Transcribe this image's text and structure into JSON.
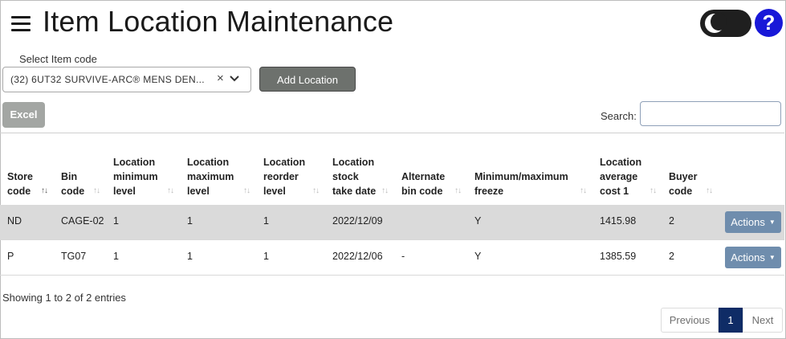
{
  "header": {
    "title": "Item Location Maintenance"
  },
  "item_select": {
    "label": "Select Item code",
    "value": "(32) 6UT32 SURVIVE-ARC® MENS DEN...",
    "clear_symbol": "×"
  },
  "buttons": {
    "add_location": "Add Location",
    "excel": "Excel",
    "actions": "Actions",
    "help": "?"
  },
  "search": {
    "label": "Search:",
    "value": ""
  },
  "table": {
    "columns": [
      "Store code",
      "Bin code",
      "Location minimum level",
      "Location maximum level",
      "Location reorder level",
      "Location stock take date",
      "Alternate bin code",
      "Minimum/maximum freeze",
      "Location average cost 1",
      "Buyer code"
    ],
    "rows": [
      {
        "store": "ND",
        "bin": "CAGE-02",
        "min": "1",
        "max": "1",
        "reorder": "1",
        "date": "2022/12/09",
        "alt": "",
        "freeze": "Y",
        "cost": "1415.98",
        "buyer": "2"
      },
      {
        "store": "P",
        "bin": "TG07",
        "min": "1",
        "max": "1",
        "reorder": "1",
        "date": "2022/12/06",
        "alt": "-",
        "freeze": "Y",
        "cost": "1385.59",
        "buyer": "2"
      }
    ]
  },
  "footer": {
    "info": "Showing 1 to 2 of 2 entries",
    "pagination": {
      "previous": "Previous",
      "current": "1",
      "next": "Next"
    }
  },
  "icons": [
    "menu-icon",
    "dark-mode-toggle-icon",
    "help-icon",
    "chevron-down-icon",
    "clear-icon",
    "sort-icon",
    "caret-down-icon"
  ],
  "colors": {
    "help": "#1818d8",
    "add_button": "#6d716d",
    "actions_button": "#6f8dad",
    "active_page": "#0f2c66",
    "row_highlight": "#dadada"
  }
}
